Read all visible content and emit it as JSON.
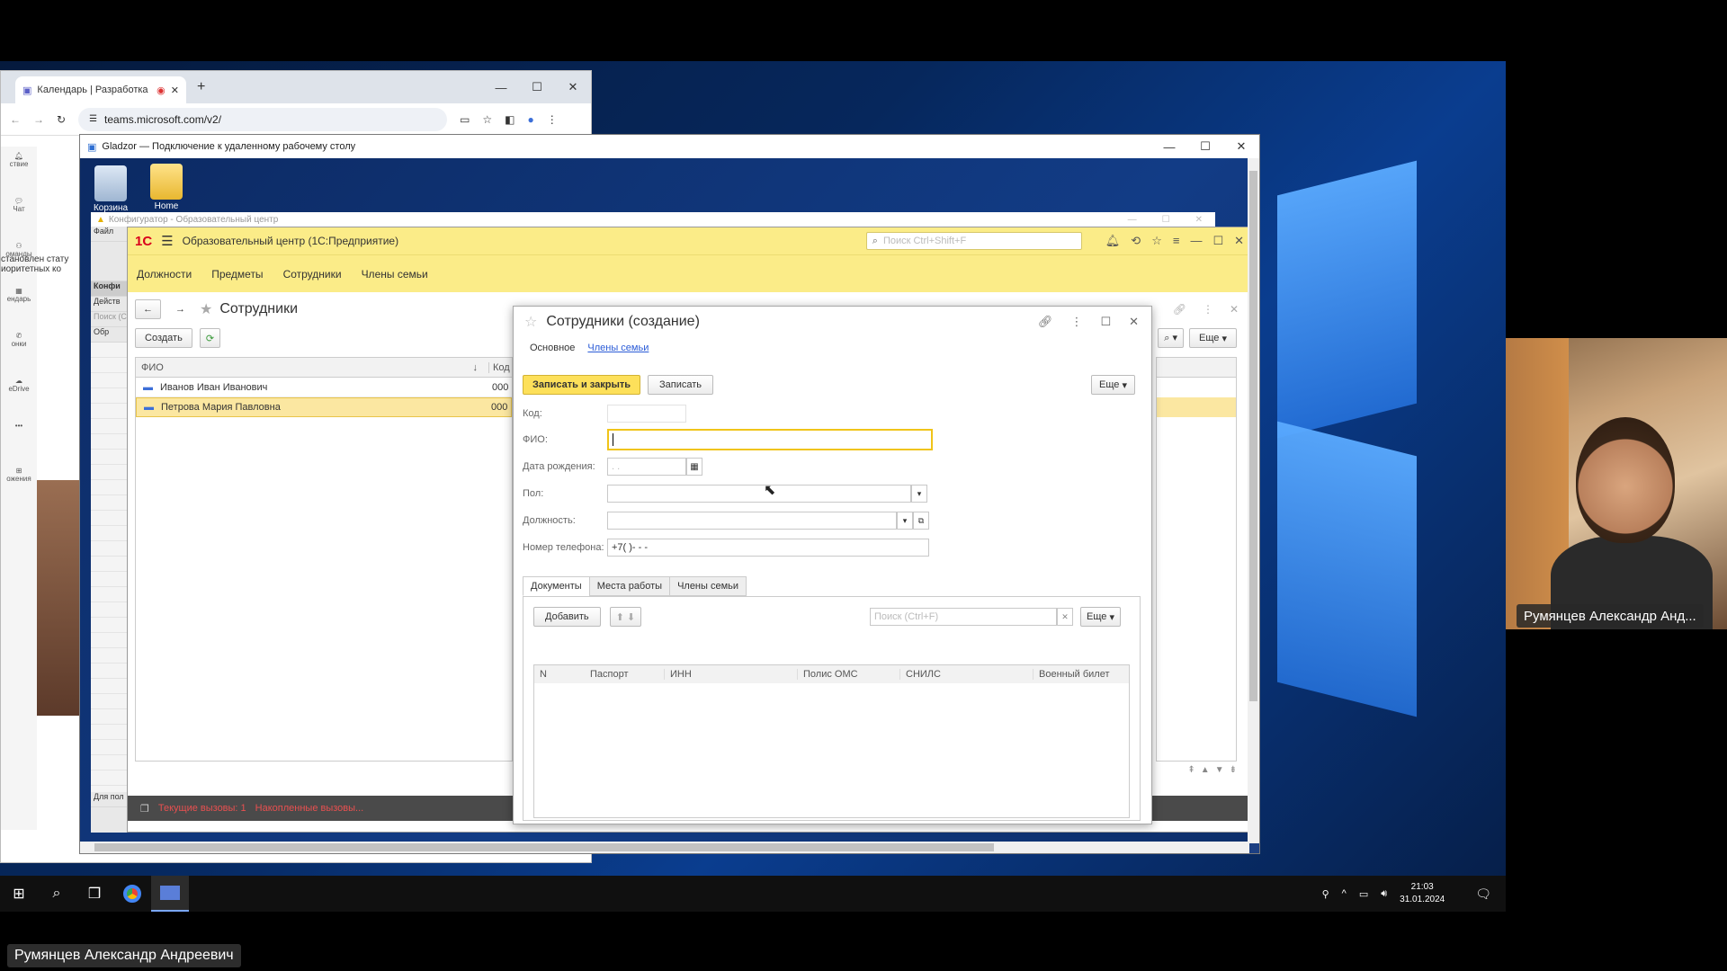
{
  "chrome": {
    "tab_title": "Календарь | Разработка к",
    "url": "teams.microsoft.com/v2/",
    "left_rail": [
      "ствие",
      "Чат",
      "оманды",
      "ендарь",
      "онки",
      "eDrive",
      "•••",
      "ожения"
    ],
    "side_texts": [
      "становлен стату",
      "иоритетных ко"
    ]
  },
  "rdp": {
    "title": "Gladzor — Подключение к удаленному рабочему столу",
    "desktop_icons": [
      "Корзина",
      "Home"
    ]
  },
  "konf": {
    "title": "Конфигуратор - Образовательный центр",
    "menu_file": "Файл",
    "strip_lines": [
      "Конфи",
      "Действ",
      "Поиск (С",
      "Обр"
    ],
    "bottom_label": "Для пол"
  },
  "ent": {
    "logo": "1С",
    "title": "Образовательный центр  (1С:Предприятие)",
    "search_placeholder": "Поиск Ctrl+Shift+F",
    "sections": [
      "Должности",
      "Предметы",
      "Сотрудники",
      "Члены семьи"
    ],
    "list_title": "Сотрудники",
    "create_button": "Создать",
    "more_button": "Еще",
    "col_fio": "ФИО",
    "col_code": "Код",
    "rows": [
      {
        "fio": "Иванов Иван Иванович",
        "code": "000"
      },
      {
        "fio": "Петрова Мария Павловна",
        "code": "000"
      }
    ],
    "status_current": "Текущие вызовы: 1",
    "status_accum": "Накопленные вызовы..."
  },
  "form": {
    "title": "Сотрудники (создание)",
    "tab_main": "Основное",
    "tab_family": "Члены семьи",
    "save_close": "Записать и закрыть",
    "save": "Записать",
    "more": "Еще",
    "label_code": "Код:",
    "label_fio": "ФИО:",
    "label_birth": "Дата рождения:",
    "birth_placeholder": " .  .",
    "label_gender": "Пол:",
    "label_position": "Должность:",
    "label_phone": "Номер телефона:",
    "phone_mask": "+7(   )-   -  -",
    "subtabs": [
      "Документы",
      "Места работы",
      "Члены семьи"
    ],
    "add_button": "Добавить",
    "search_placeholder": "Поиск (Ctrl+F)",
    "columns": [
      "N",
      "Паспорт",
      "ИНН",
      "Полис ОМС",
      "СНИЛС",
      "Военный билет"
    ]
  },
  "taskbar": {
    "time": "21:03",
    "date": "31.01.2024"
  },
  "participant": {
    "webcam_name": "Румянцев Александр Анд...",
    "bottom_name": "Румянцев Александр Андреевич"
  },
  "colors": {
    "accent_yellow": "#fbec88",
    "button_yellow": "#fde05a",
    "selection": "#fbe7a1",
    "link_blue": "#2a5bd7"
  }
}
